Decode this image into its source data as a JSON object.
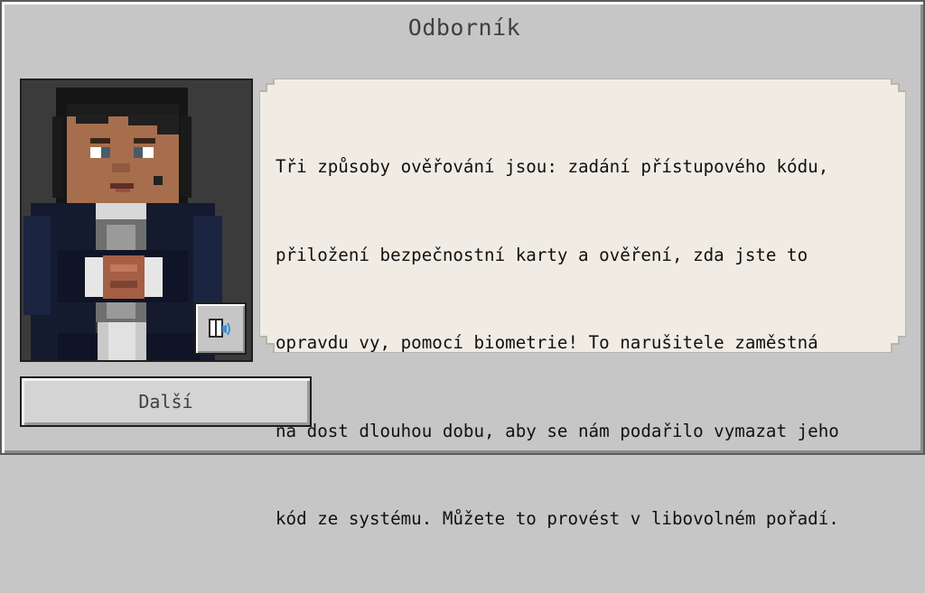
{
  "dialog": {
    "title": "Odborník",
    "message_lines": [
      "Tři způsoby ověřování jsou: zadání přístupového kódu,",
      "přiložení bezpečnostní karty a ověření, zda jste to",
      "opravdu vy, pomocí biometrie! To narušitele zaměstná",
      "na dost dlouhou dobu, aby se nám podařilo vymazat jeho",
      "kód ze systému. Můžete to provést v libovolném pořadí."
    ],
    "next_label": "Další",
    "audio_icon": "book-speaker-icon",
    "portrait": "npc-portrait"
  },
  "colors": {
    "panel": "#c6c6c6",
    "speech_bubble": "#f0ece4",
    "text": "#111111",
    "title_text": "#404040",
    "audio_accent": "#3a8fd8"
  }
}
